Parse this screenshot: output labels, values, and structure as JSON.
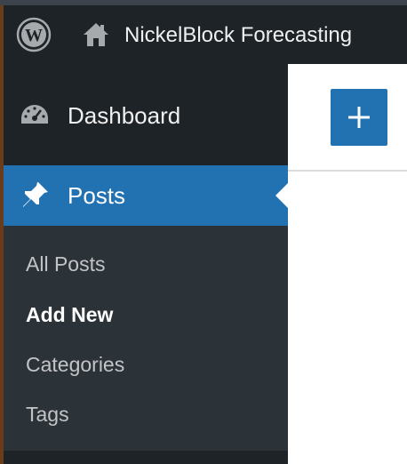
{
  "admin_bar": {
    "site_name": "NickelBlock Forecasting",
    "wp_logo_icon": "wordpress-logo-icon",
    "home_icon": "home-icon"
  },
  "sidebar": {
    "items": [
      {
        "label": "Dashboard",
        "icon": "dashboard-gauge-icon",
        "active": false
      },
      {
        "label": "Posts",
        "icon": "pushpin-icon",
        "active": true
      }
    ],
    "submenu": [
      {
        "label": "All Posts",
        "current": false
      },
      {
        "label": "Add New",
        "current": true
      },
      {
        "label": "Categories",
        "current": false
      },
      {
        "label": "Tags",
        "current": false
      }
    ]
  },
  "editor": {
    "add_block_icon": "plus-icon"
  },
  "colors": {
    "admin_bg": "#1d2327",
    "submenu_bg": "#2c3338",
    "accent": "#2271b1",
    "text": "#f0f0f1",
    "submenu_text": "#c3c4c7"
  }
}
